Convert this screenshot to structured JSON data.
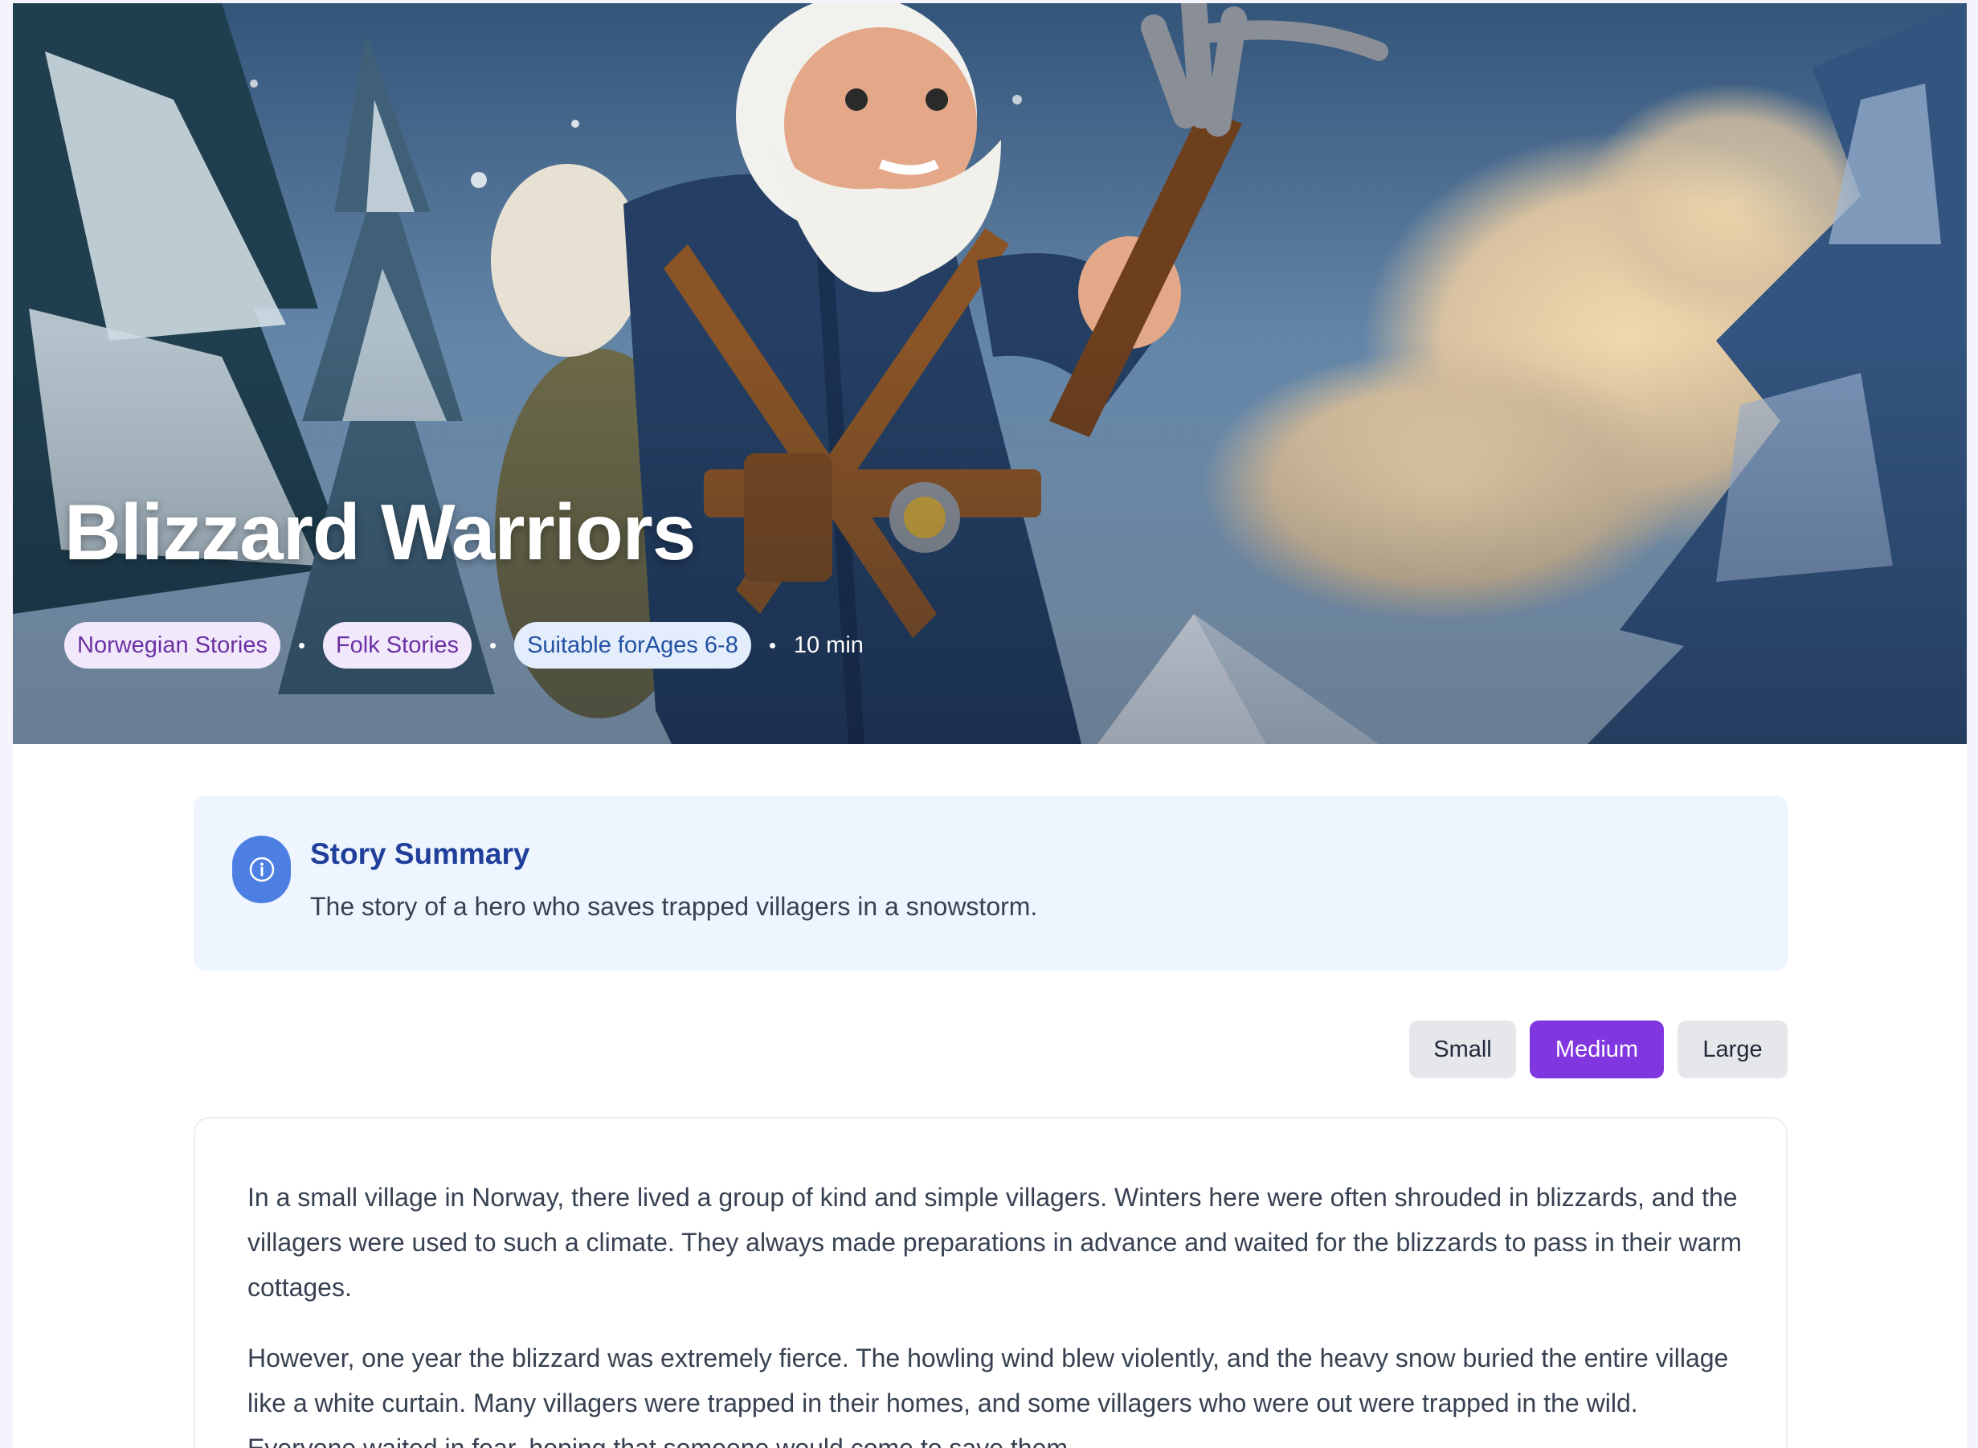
{
  "hero": {
    "title": "Blizzard Warriors",
    "tags": [
      {
        "label": "Norwegian Stories",
        "tone": "purple"
      },
      {
        "label": "Folk Stories",
        "tone": "purple"
      },
      {
        "label": "Suitable forAges 6-8",
        "tone": "blue"
      }
    ],
    "duration": "10 min"
  },
  "summary": {
    "icon": "info-icon",
    "heading": "Story Summary",
    "text": "The story of a hero who saves trapped villagers in a snowstorm."
  },
  "font_size": {
    "options": [
      "Small",
      "Medium",
      "Large"
    ],
    "selected": "Medium"
  },
  "story": {
    "paragraphs": [
      "In a small village in Norway, there lived a group of kind and simple villagers. Winters here were often shrouded in blizzards, and the villagers were used to such a climate. They always made preparations in advance and waited for the blizzards to pass in their warm cottages.",
      "However, one year the blizzard was extremely fierce. The howling wind blew violently, and the heavy snow buried the entire village like a white curtain. Many villagers were trapped in their homes, and some villagers who were out were trapped in the wild. Everyone waited in fear, hoping that someone would come to save them."
    ]
  },
  "colors": {
    "accent": "#8137df",
    "summary_background": "#eef5fe",
    "summary_heading": "#1f3f9a",
    "info_badge": "#4d7fe2",
    "tag_purple_bg": "#f1e9fb",
    "tag_purple_text": "#6b2fa3",
    "tag_blue_bg": "#e3edfb",
    "tag_blue_text": "#2352a3"
  }
}
